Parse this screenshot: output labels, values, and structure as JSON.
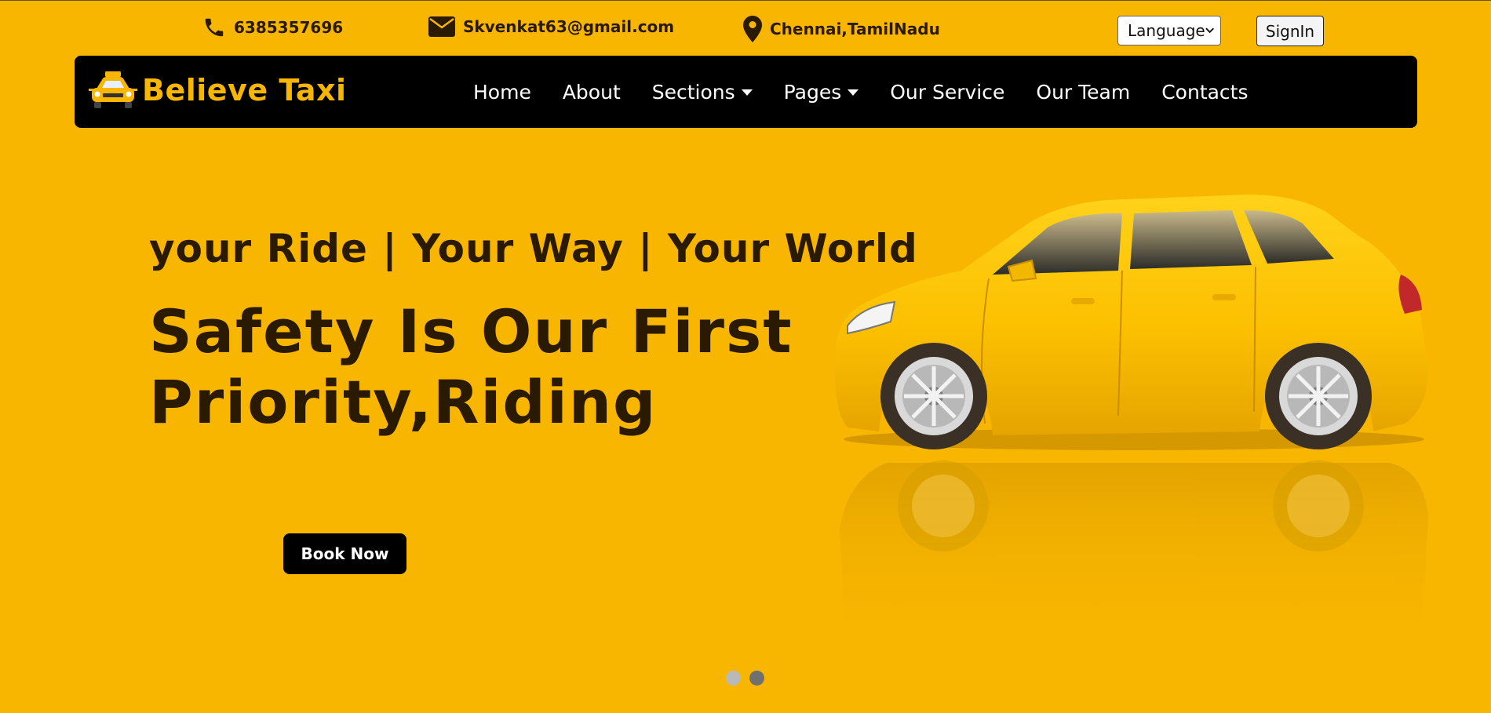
{
  "topbar": {
    "phone": "6385357696",
    "email": "Skvenkat63@gmail.com",
    "location": "Chennai,TamilNadu",
    "language_select": "Language",
    "signin_label": "SignIn",
    "icons": [
      "phone-icon",
      "envelope-icon",
      "map-pin-icon"
    ]
  },
  "navbar": {
    "brand": "Believe Taxi",
    "items": [
      {
        "label": "Home",
        "dropdown": false
      },
      {
        "label": "About",
        "dropdown": false
      },
      {
        "label": "Sections",
        "dropdown": true
      },
      {
        "label": "Pages",
        "dropdown": true
      },
      {
        "label": "Our Service",
        "dropdown": false
      },
      {
        "label": "Our Team",
        "dropdown": false
      },
      {
        "label": "Contacts",
        "dropdown": false
      }
    ]
  },
  "hero": {
    "tagline": "your Ride | Your Way | Your World",
    "headline_line1": "Safety Is Our First",
    "headline_line2": "Priority,Riding",
    "cta_label": "Book Now",
    "image": "yellow-taxi-car"
  },
  "carousel": {
    "slides": 2,
    "active_index": 1
  },
  "colors": {
    "background": "#f8b600",
    "navbar": "#000000",
    "brand": "#f8b600",
    "text_dark": "#2a1a00",
    "dot_inactive": "#b9b9b9",
    "dot_active": "#707070"
  }
}
